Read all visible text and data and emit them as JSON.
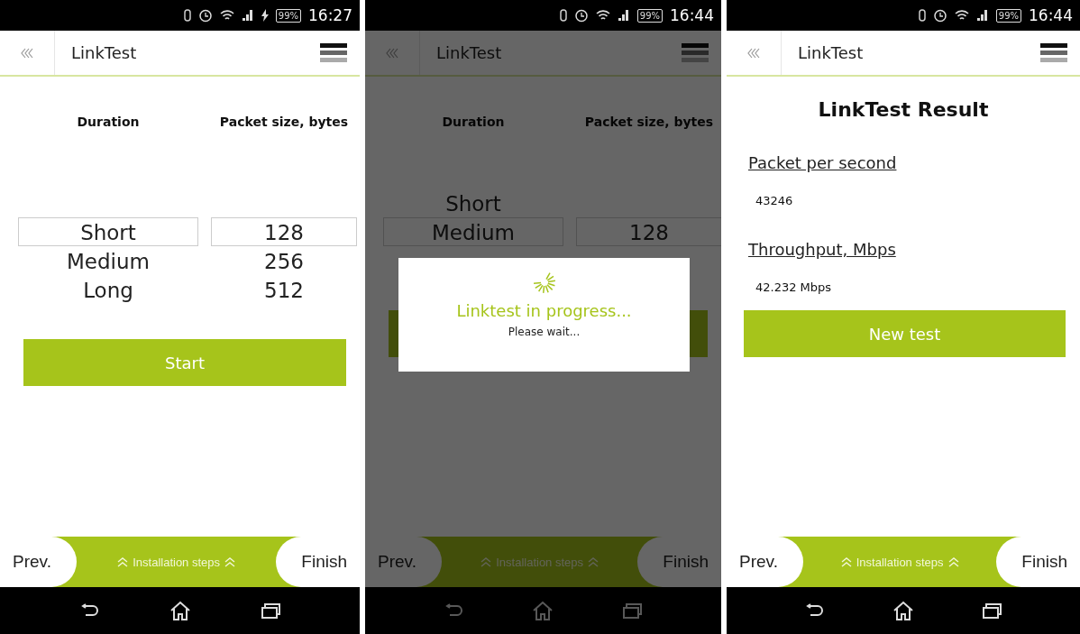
{
  "screens": [
    {
      "status_bar": {
        "charging": true,
        "battery": "99%",
        "time": "16:27"
      },
      "app_bar": {
        "title": "LinkTest"
      },
      "content": {
        "kind": "picker",
        "columns": [
          {
            "heading": "Duration",
            "options": [
              {
                "label": "Short",
                "selected": true
              },
              {
                "label": "Medium",
                "selected": false
              },
              {
                "label": "Long",
                "selected": false
              }
            ]
          },
          {
            "heading": "Packet size, bytes",
            "options": [
              {
                "label": "128",
                "selected": true
              },
              {
                "label": "256",
                "selected": false
              },
              {
                "label": "512",
                "selected": false
              }
            ]
          }
        ],
        "action_button": {
          "label": "Start",
          "covered": false
        }
      },
      "footer": {
        "prev": "Prev.",
        "steps": "Installation steps",
        "finish": "Finish"
      }
    },
    {
      "status_bar": {
        "charging": false,
        "battery": "99%",
        "time": "16:44"
      },
      "app_bar": {
        "title": "LinkTest"
      },
      "content": {
        "kind": "picker",
        "columns": [
          {
            "heading": "Duration",
            "options": [
              {
                "label": "Short",
                "selected": false
              },
              {
                "label": "Medium",
                "selected": true
              }
            ]
          },
          {
            "heading": "Packet size, bytes",
            "options": [
              {
                "label": "128",
                "selected": true
              }
            ]
          }
        ],
        "action_button": {
          "covered": true
        }
      },
      "dialog": {
        "title": "Linktest in progress...",
        "message": "Please wait..."
      },
      "footer": {
        "prev": "Prev.",
        "steps": "Installation steps",
        "finish": "Finish"
      }
    },
    {
      "status_bar": {
        "charging": false,
        "battery": "99%",
        "time": "16:44"
      },
      "app_bar": {
        "title": "LinkTest"
      },
      "content": {
        "kind": "result",
        "title": "LinkTest Result",
        "fields": [
          {
            "label": "Packet per second",
            "value": "43246"
          },
          {
            "label": "Throughput, Mbps",
            "value": "42.232 Mbps"
          }
        ],
        "action_button": {
          "label": "New test",
          "covered": false
        }
      },
      "footer": {
        "prev": "Prev.",
        "steps": "Installation steps",
        "finish": "Finish"
      }
    }
  ]
}
